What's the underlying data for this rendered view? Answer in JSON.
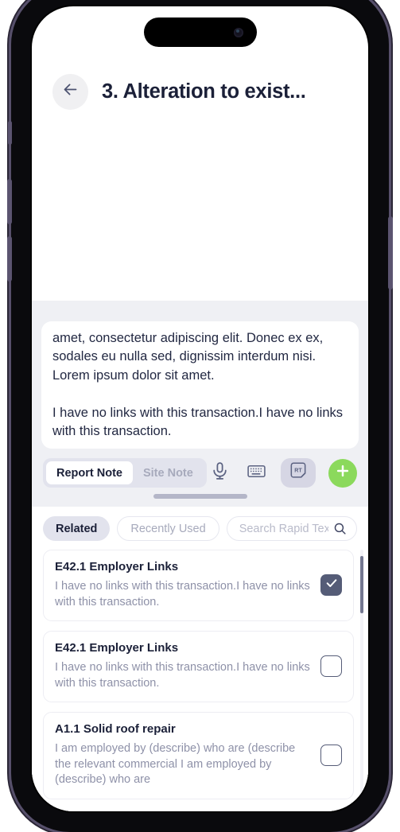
{
  "header": {
    "back_icon": "arrow-left-icon",
    "title": "3. Alteration to exist..."
  },
  "editor": {
    "content": "dignissim interdum nisi. Lorem ipsum dolor sit the amet, consectetur adipiscing elit. Donec ex ex, sodales eu nulla sed, dignissim interdum nisi. Lorem ipsum dolor sit amet.\n\nI have no links with this transaction.I have no links with this transaction."
  },
  "toolbar": {
    "segments": [
      {
        "label": "Report Note",
        "active": true
      },
      {
        "label": "Site Note",
        "active": false
      }
    ],
    "actions": [
      {
        "name": "microphone-icon",
        "label": "Microphone"
      },
      {
        "name": "keyboard-icon",
        "label": "Keyboard"
      },
      {
        "name": "rapid-text-icon",
        "label": "RT"
      },
      {
        "name": "plus-icon",
        "label": "Add"
      }
    ],
    "rapid_text_badge": "RT"
  },
  "rapid_text": {
    "filters": [
      {
        "label": "Related",
        "active": true
      },
      {
        "label": "Recently Used",
        "active": false
      }
    ],
    "search": {
      "placeholder": "Search Rapid Text",
      "value": "",
      "icon": "search-icon"
    },
    "items": [
      {
        "title": "E42.1 Employer Links",
        "body": "I have no links with this transaction.I have no links with this transaction.",
        "checked": true
      },
      {
        "title": "E42.1 Employer Links",
        "body": "I have no links with this transaction.I have no links with this transaction.",
        "checked": false
      },
      {
        "title": "A1.1 Solid roof repair",
        "body": "I am employed by (describe) who are (describe the relevant commercial I am employed by (describe) who are",
        "checked": false
      }
    ]
  },
  "colors": {
    "accent_green": "#8bd95c",
    "text_dark": "#1b2038",
    "text_muted": "#8e91a8",
    "checkbox_checked": "#555c77",
    "sheet_background": "#eff0f4"
  }
}
